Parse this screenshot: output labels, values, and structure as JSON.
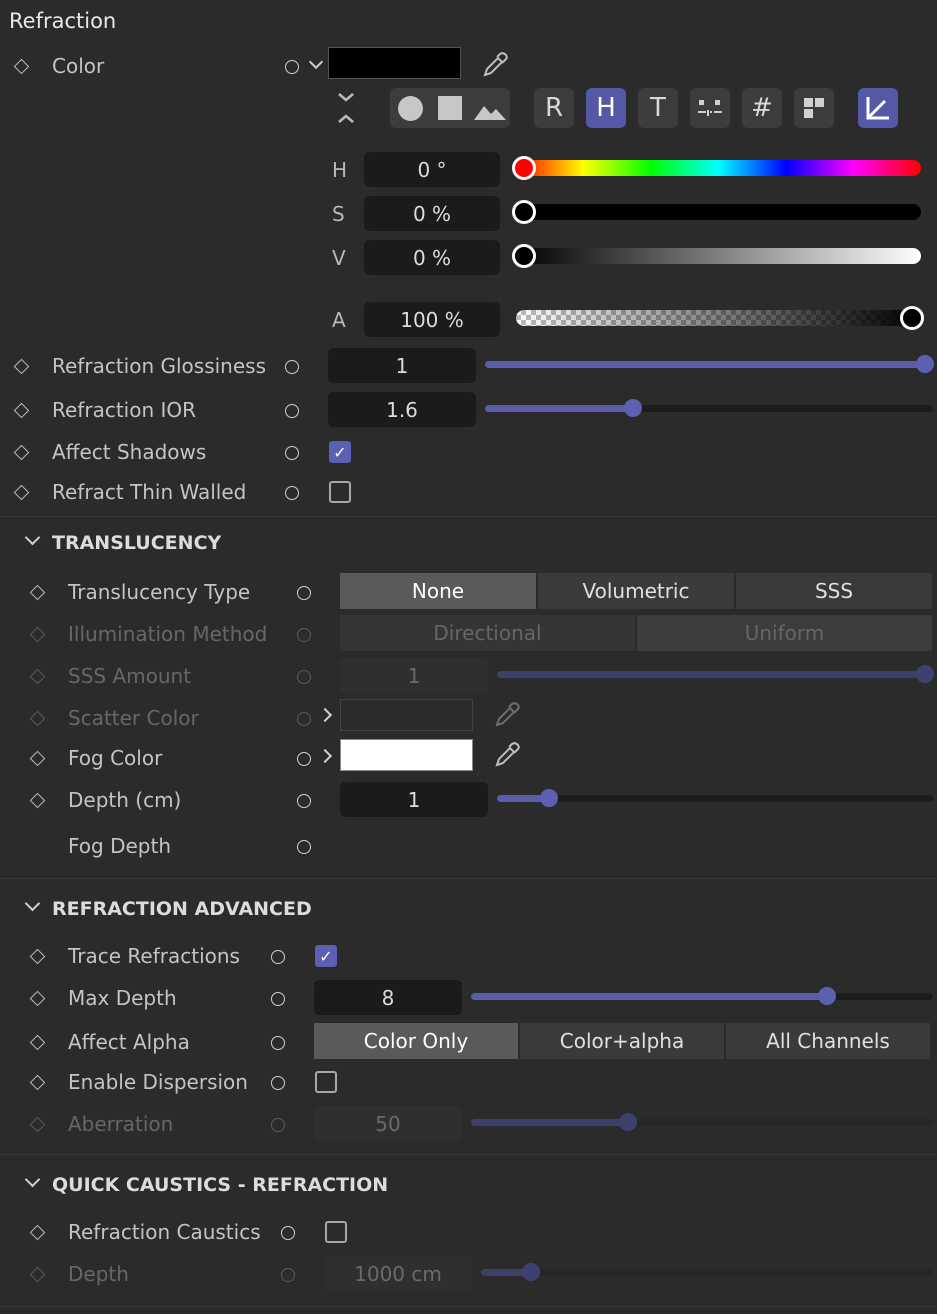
{
  "panel_title": "Refraction",
  "color": {
    "label": "Color",
    "hsv": {
      "h_label": "H",
      "h_value": "0 °",
      "s_label": "S",
      "s_value": "0 %",
      "v_label": "V",
      "v_value": "0 %",
      "a_label": "A",
      "a_value": "100 %"
    },
    "mode_buttons": [
      "R",
      "H",
      "T",
      "#"
    ],
    "swatch_color": "#000000"
  },
  "refraction_glossiness": {
    "label": "Refraction Glossiness",
    "value": "1",
    "fraction": 1.0
  },
  "refraction_ior": {
    "label": "Refraction IOR",
    "value": "1.6",
    "fraction": 0.33
  },
  "affect_shadows": {
    "label": "Affect Shadows",
    "checked": true
  },
  "refract_thin_walled": {
    "label": "Refract Thin Walled",
    "checked": false
  },
  "translucency": {
    "header": "TRANSLUCENCY",
    "type": {
      "label": "Translucency Type",
      "options": [
        "None",
        "Volumetric",
        "SSS"
      ],
      "selected": "None"
    },
    "illumination": {
      "label": "Illumination Method",
      "options": [
        "Directional",
        "Uniform"
      ],
      "selected": "Uniform"
    },
    "sss_amount": {
      "label": "SSS Amount",
      "value": "1",
      "fraction": 1.0
    },
    "scatter_color": {
      "label": "Scatter Color"
    },
    "fog_color": {
      "label": "Fog Color",
      "swatch": "#ffffff"
    },
    "depth": {
      "label": "Depth (cm)",
      "value": "1",
      "fraction": 0.12
    },
    "fog_depth": {
      "label": "Fog Depth"
    }
  },
  "refraction_advanced": {
    "header": "REFRACTION ADVANCED",
    "trace_refractions": {
      "label": "Trace Refractions",
      "checked": true
    },
    "max_depth": {
      "label": "Max Depth",
      "value": "8",
      "fraction": 0.77
    },
    "affect_alpha": {
      "label": "Affect Alpha",
      "options": [
        "Color Only",
        "Color+alpha",
        "All Channels"
      ],
      "selected": "Color Only"
    },
    "enable_dispersion": {
      "label": "Enable Dispersion",
      "checked": false
    },
    "aberration": {
      "label": "Aberration",
      "value": "50",
      "fraction": 0.34
    }
  },
  "quick_caustics": {
    "header": "QUICK CAUSTICS - REFRACTION",
    "refraction_caustics": {
      "label": "Refraction Caustics",
      "checked": false
    },
    "depth": {
      "label": "Depth",
      "value": "1000 cm",
      "fraction": 0.11
    }
  },
  "colors": {
    "accent": "#5b60b0",
    "background": "#2b2b2b",
    "field": "#1b1b1b"
  }
}
